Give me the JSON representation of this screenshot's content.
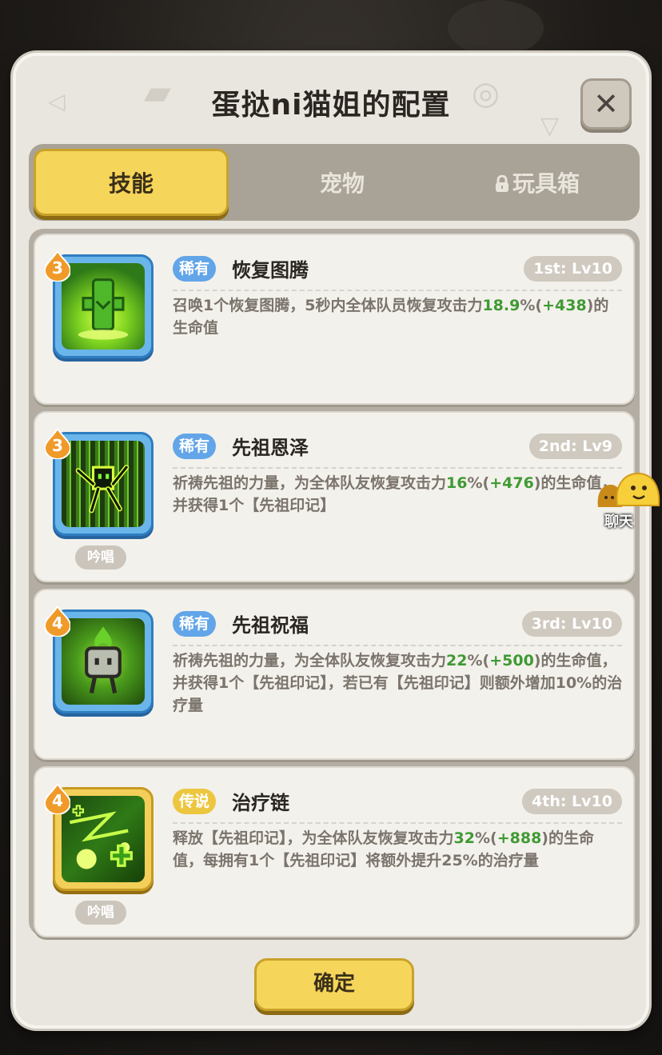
{
  "title": "蛋挞ni猫姐的配置",
  "close_icon": "close-icon",
  "tabs": [
    {
      "label": "技能",
      "active": true
    },
    {
      "label": "宠物",
      "active": false
    },
    {
      "label": "玩具箱",
      "active": false,
      "locked": true
    }
  ],
  "skills": [
    {
      "tier": "3",
      "rarity": "稀有",
      "rarity_type": "rare",
      "name": "恢复图腾",
      "slot": "1st: Lv10",
      "desc_pre": "召唤1个恢复图腾，5秒内全体队员恢复攻击力",
      "pct": "18.9",
      "pct_unit": "%(",
      "bonus": "+438",
      "desc_post": ")的生命值",
      "chant": "",
      "frame": "blue"
    },
    {
      "tier": "3",
      "rarity": "稀有",
      "rarity_type": "rare",
      "name": "先祖恩泽",
      "slot": "2nd: Lv9",
      "desc_pre": "祈祷先祖的力量，为全体队友恢复攻击力",
      "pct": "16",
      "pct_unit": "%(",
      "bonus": "+476",
      "desc_post": ")的生命值，并获得1个【先祖印记】",
      "chant": "吟唱",
      "frame": "blue"
    },
    {
      "tier": "4",
      "rarity": "稀有",
      "rarity_type": "rare",
      "name": "先祖祝福",
      "slot": "3rd: Lv10",
      "desc_pre": "祈祷先祖的力量，为全体队友恢复攻击力",
      "pct": "22",
      "pct_unit": "%(",
      "bonus": "+500",
      "desc_post": ")的生命值，并获得1个【先祖印记】，若已有【先祖印记】则额外增加10%的治疗量",
      "chant": "",
      "frame": "blue"
    },
    {
      "tier": "4",
      "rarity": "传说",
      "rarity_type": "legend",
      "name": "治疗链",
      "slot": "4th: Lv10",
      "desc_pre": "释放【先祖印记】，为全体队友恢复攻击力",
      "pct": "32",
      "pct_unit": "%(",
      "bonus": "+888",
      "desc_post": ")的生命值，每拥有1个【先祖印记】将额外提升25%的治疗量",
      "chant": "吟唱",
      "frame": "gold"
    }
  ],
  "confirm_label": "确定",
  "chat_label": "聊天"
}
